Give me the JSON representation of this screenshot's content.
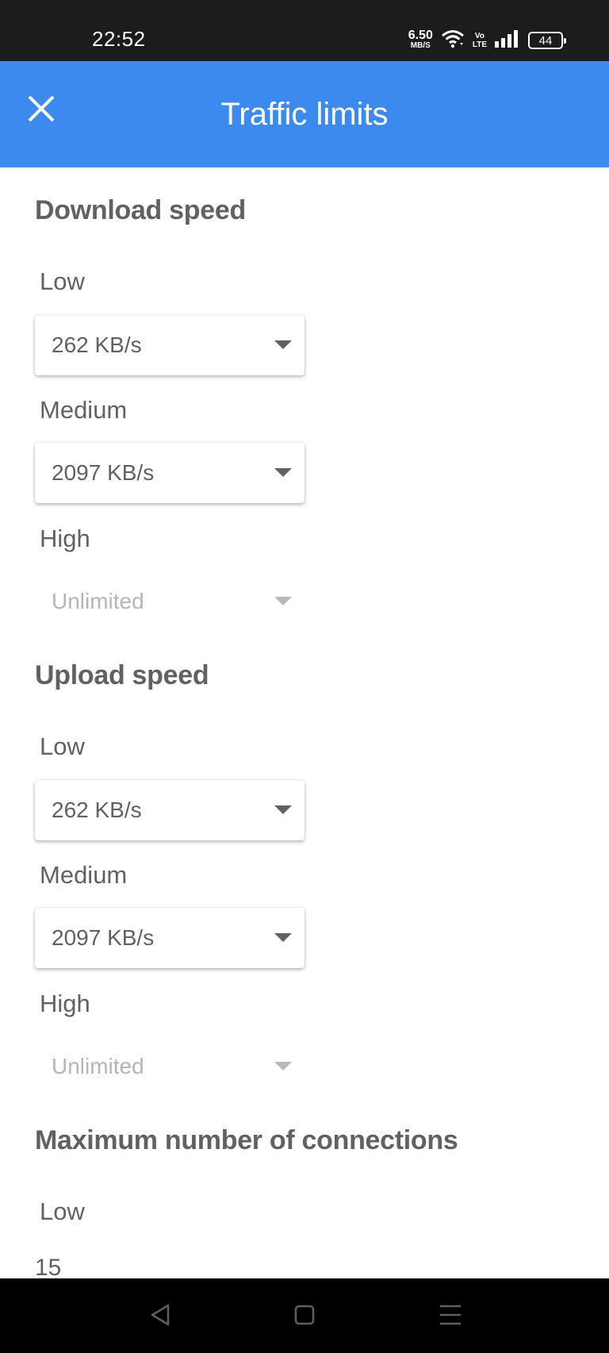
{
  "status_bar": {
    "time": "22:52",
    "net_speed_value": "6.50",
    "net_speed_unit": "MB/S",
    "volte_top": "Vo",
    "volte_bottom": "LTE",
    "battery": "44",
    "icons": [
      "wifi-icon",
      "signal-icon",
      "battery-icon"
    ]
  },
  "app_bar": {
    "title": "Traffic limits",
    "close_icon": "close-icon",
    "background": "#3d8aef"
  },
  "sections": {
    "download": {
      "title": "Download speed",
      "low_label": "Low",
      "low_value": "262 KB/s",
      "medium_label": "Medium",
      "medium_value": "2097 KB/s",
      "high_label": "High",
      "high_value": "Unlimited"
    },
    "upload": {
      "title": "Upload speed",
      "low_label": "Low",
      "low_value": "262 KB/s",
      "medium_label": "Medium",
      "medium_value": "2097 KB/s",
      "high_label": "High",
      "high_value": "Unlimited"
    },
    "connections": {
      "title": "Maximum number of connections",
      "low_label": "Low",
      "low_value": "15"
    }
  },
  "nav_bar": {
    "icons": [
      "back-icon",
      "home-icon",
      "menu-icon"
    ]
  }
}
